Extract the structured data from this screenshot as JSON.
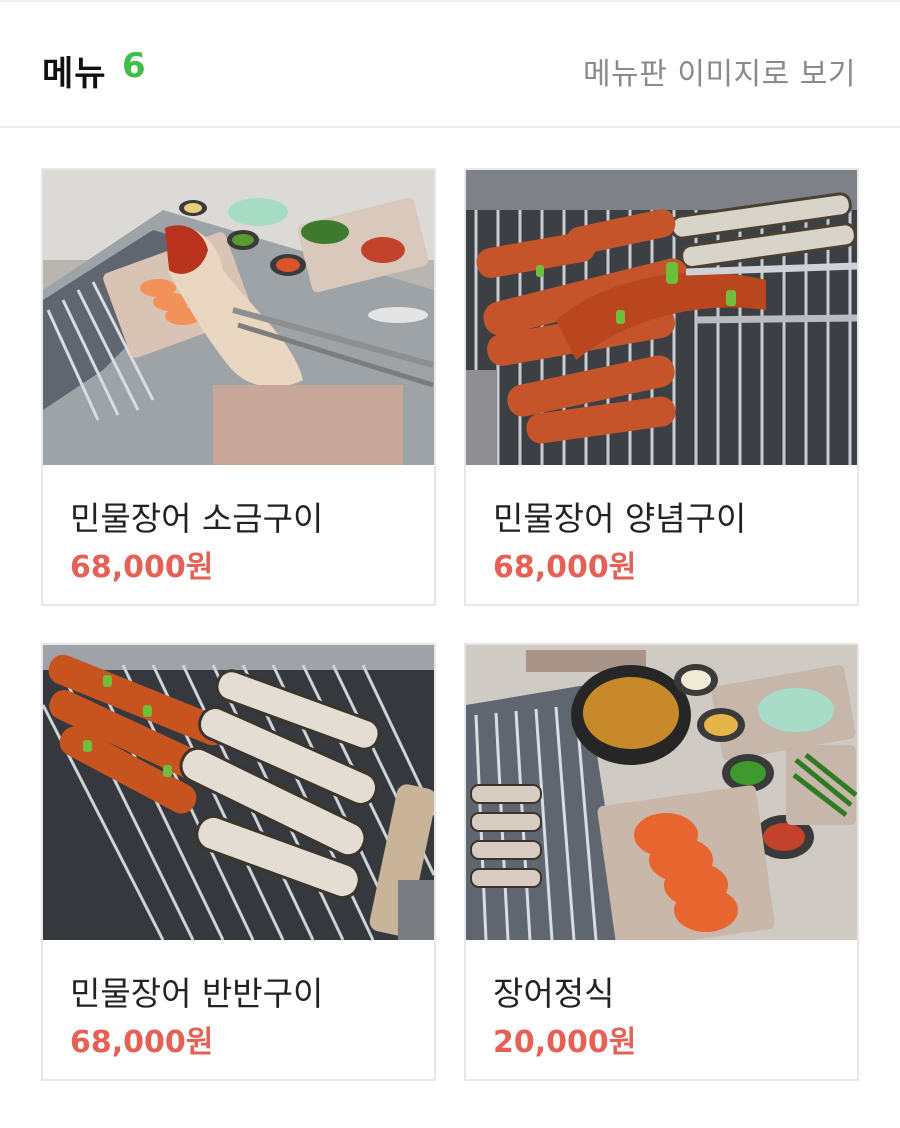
{
  "header": {
    "title": "메뉴",
    "count": "6",
    "view_menu_image_link": "메뉴판 이미지로 보기"
  },
  "menu_items": [
    {
      "name": "민물장어 소금구이",
      "price": "68,000원",
      "image_subject": "salt-grilled-eel-photo"
    },
    {
      "name": "민물장어 양념구이",
      "price": "68,000원",
      "image_subject": "sauce-grilled-eel-photo"
    },
    {
      "name": "민물장어 반반구이",
      "price": "68,000원",
      "image_subject": "half-and-half-eel-photo"
    },
    {
      "name": "장어정식",
      "price": "20,000원",
      "image_subject": "eel-set-meal-photo"
    }
  ],
  "colors": {
    "count_accent": "#3fbf4a",
    "price": "#e56156",
    "link_gray": "#8a8a8a"
  }
}
